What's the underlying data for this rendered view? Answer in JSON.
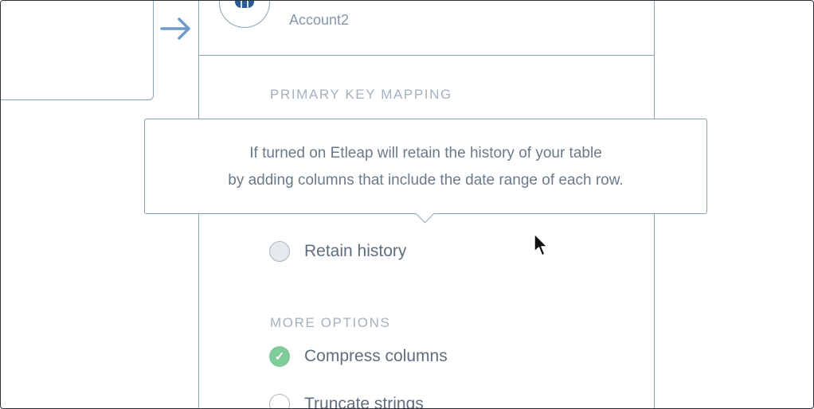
{
  "account": {
    "name": "Account2",
    "icon": "database-icon"
  },
  "flow_arrow": "right-arrow-icon",
  "sections": {
    "primary_key_mapping": "PRIMARY KEY MAPPING",
    "more_options": "MORE OPTIONS"
  },
  "tooltip": {
    "line1": "If turned on Etleap will retain the history of your table",
    "line2": "by adding columns that include the date range of each row."
  },
  "options": {
    "retain_history": {
      "label": "Retain history",
      "checked": false
    },
    "compress_columns": {
      "label": "Compress columns",
      "checked": true,
      "checkmark": "✓"
    },
    "truncate_strings": {
      "label": "Truncate strings",
      "checked": false
    }
  },
  "colors": {
    "border": "#8aa3b3",
    "arrow": "#6f9ac9",
    "checked": "#7fcb9a",
    "section_title": "#a3b1be",
    "text": "#5f6e7e"
  }
}
